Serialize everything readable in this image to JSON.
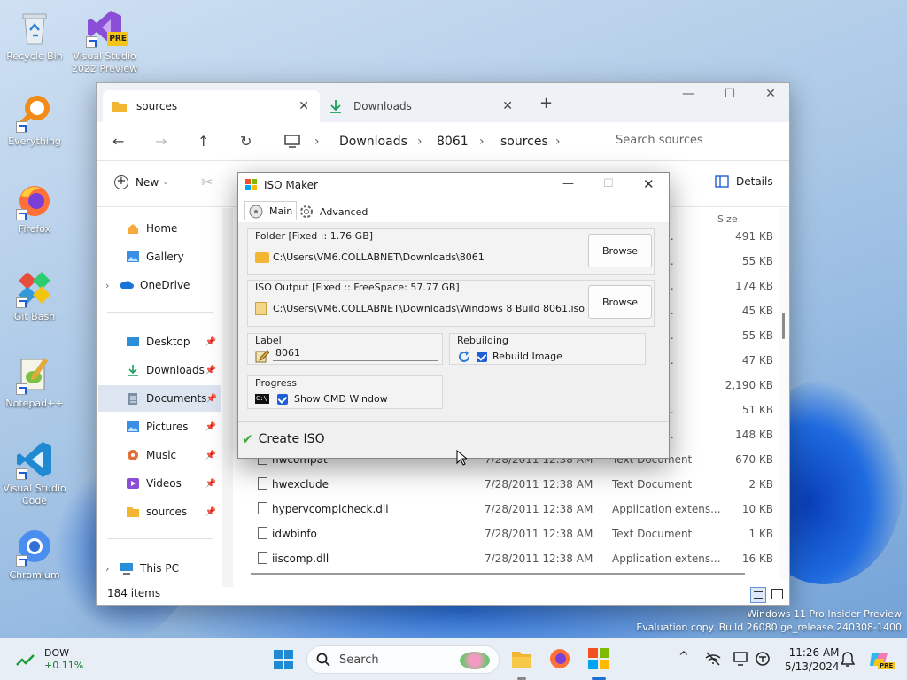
{
  "desktop": {
    "icons": [
      {
        "label": "Recycle Bin"
      },
      {
        "label": "Visual Studio 2022 Preview",
        "badge": "PRE"
      },
      {
        "label": "Everything"
      },
      {
        "label": "Firefox"
      },
      {
        "label": "Git Bash"
      },
      {
        "label": "Notepad++"
      },
      {
        "label": "Visual Studio Code"
      },
      {
        "label": "Chromium"
      }
    ],
    "watermark_line1": "Windows 11 Pro Insider Preview",
    "watermark_line2": "Evaluation copy. Build 26080.ge_release.240308-1400"
  },
  "explorer": {
    "tabs": [
      {
        "label": "sources",
        "active": true
      },
      {
        "label": "Downloads",
        "active": false
      }
    ],
    "breadcrumb": [
      "Downloads",
      "8061",
      "sources"
    ],
    "search_placeholder": "Search sources",
    "toolbar": {
      "new_label": "New",
      "details_label": "Details"
    },
    "sidebar": {
      "home": "Home",
      "gallery": "Gallery",
      "onedrive": "OneDrive",
      "desktop": "Desktop",
      "downloads": "Downloads",
      "documents": "Documents",
      "pictures": "Pictures",
      "music": "Music",
      "videos": "Videos",
      "sources": "sources",
      "thispc": "This PC"
    },
    "columns": {
      "size": "Size"
    },
    "hidden_rows": [
      {
        "type": "extens...",
        "size": "491 KB"
      },
      {
        "type": "extens...",
        "size": "55 KB"
      },
      {
        "type": "extens...",
        "size": "174 KB"
      },
      {
        "type": "extens...",
        "size": "45 KB"
      },
      {
        "type": "extens...",
        "size": "55 KB"
      },
      {
        "type": "extens...",
        "size": "47 KB"
      },
      {
        "type": "ge H...",
        "size": "2,190 KB"
      },
      {
        "type": "extens...",
        "size": "51 KB"
      },
      {
        "type": "extens...",
        "size": "148 KB"
      }
    ],
    "rows": [
      {
        "name": "hwcompat",
        "date": "7/28/2011 12:38 AM",
        "type": "Text Document",
        "size": "670 KB"
      },
      {
        "name": "hwexclude",
        "date": "7/28/2011 12:38 AM",
        "type": "Text Document",
        "size": "2 KB"
      },
      {
        "name": "hypervcomplcheck.dll",
        "date": "7/28/2011 12:38 AM",
        "type": "Application extens...",
        "size": "10 KB"
      },
      {
        "name": "idwbinfo",
        "date": "7/28/2011 12:38 AM",
        "type": "Text Document",
        "size": "1 KB"
      },
      {
        "name": "iiscomp.dll",
        "date": "7/28/2011 12:38 AM",
        "type": "Application extens...",
        "size": "16 KB"
      }
    ],
    "status": "184 items"
  },
  "iso": {
    "title": "ISO Maker",
    "tab_main": "Main",
    "tab_advanced": "Advanced",
    "folder_label": "Folder [Fixed :: 1.76 GB]",
    "folder_path": "C:\\Users\\VM6.COLLABNET\\Downloads\\8061",
    "output_label": "ISO Output [Fixed :: FreeSpace: 57.77 GB]",
    "output_path": "C:\\Users\\VM6.COLLABNET\\Downloads\\Windows 8 Build 8061.iso",
    "browse_label": "Browse",
    "label_group": "Label",
    "label_value": "8061",
    "rebuilding_group": "Rebuilding",
    "rebuild_check": "Rebuild Image",
    "progress_group": "Progress",
    "cmd_check": "Show CMD Window",
    "create_label": "Create ISO"
  },
  "taskbar": {
    "stock_name": "DOW",
    "stock_change": "+0.11%",
    "search_label": "Search",
    "time": "11:26 AM",
    "date": "5/13/2024"
  }
}
